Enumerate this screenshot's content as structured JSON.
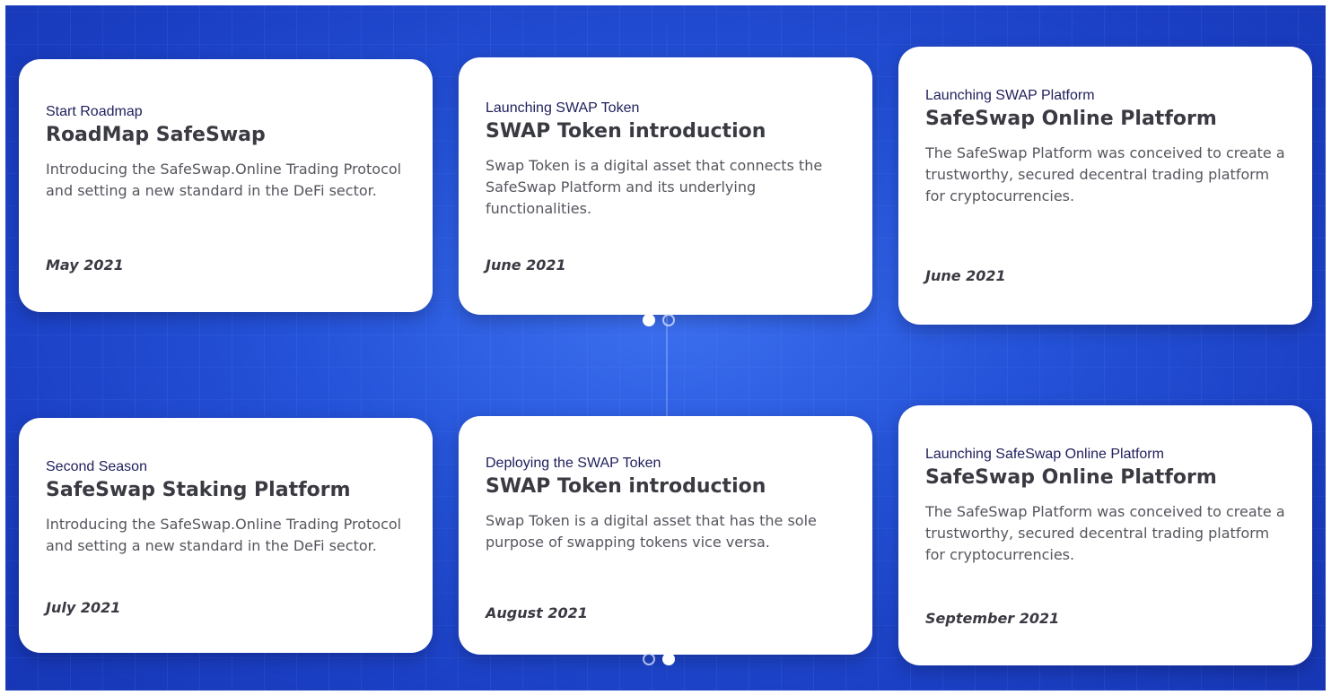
{
  "colors": {
    "background_blue": "#2452d8",
    "card_background": "#ffffff",
    "subtitle_color": "#1f1f5c",
    "heading_color": "#3a3a42"
  },
  "sections": [
    {
      "cards": [
        {
          "subtitle": "Start Roadmap",
          "title": "RoadMap SafeSwap",
          "description": "Introducing the SafeSwap.Online Trading Protocol and setting a new standard in the DeFi sector.",
          "date": "May 2021"
        },
        {
          "subtitle": "Launching SWAP Token",
          "title": "SWAP Token introduction",
          "description": "Swap Token is a digital asset that connects the SafeSwap Platform and its underlying functionalities.",
          "date": "June 2021"
        },
        {
          "subtitle": "Launching SWAP Platform",
          "title": "SafeSwap Online Platform",
          "description": "The SafeSwap Platform was conceived to create a trustworthy, secured decentral trading platform for cryptocurrencies.",
          "date": "June 2021"
        }
      ],
      "pagination": {
        "active_index": 0,
        "total": 2
      }
    },
    {
      "cards": [
        {
          "subtitle": "Second Season",
          "title": "SafeSwap Staking Platform",
          "description": "Introducing the SafeSwap.Online Trading Protocol and setting a new standard in the DeFi sector.",
          "date": "July 2021"
        },
        {
          "subtitle": "Deploying the SWAP Token",
          "title": "SWAP Token introduction",
          "description": "Swap Token is a digital asset that has the sole purpose of swapping tokens vice versa.",
          "date": "August 2021"
        },
        {
          "subtitle": "Launching SafeSwap Online Platform",
          "title": "SafeSwap Online Platform",
          "description": "The SafeSwap Platform was conceived to create a trustworthy, secured decentral trading platform for cryptocurrencies.",
          "date": "September 2021"
        }
      ],
      "pagination": {
        "active_index": 1,
        "total": 2
      }
    }
  ]
}
